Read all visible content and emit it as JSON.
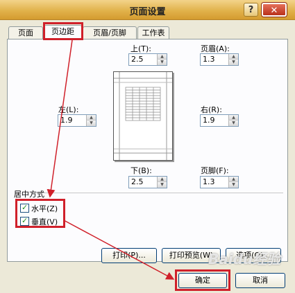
{
  "dialog": {
    "title": "页面设置",
    "help": "?",
    "close": "✕"
  },
  "tabs": [
    "页面",
    "页边距",
    "页眉/页脚",
    "工作表"
  ],
  "margins": {
    "top": {
      "label": "上(T):",
      "value": "2.5"
    },
    "header": {
      "label": "页眉(A):",
      "value": "1.3"
    },
    "left": {
      "label": "左(L):",
      "value": "1.9"
    },
    "right": {
      "label": "右(R):",
      "value": "1.9"
    },
    "bottom": {
      "label": "下(B):",
      "value": "2.5"
    },
    "footer": {
      "label": "页脚(F):",
      "value": "1.3"
    }
  },
  "center": {
    "group_label": "居中方式",
    "horizontal": {
      "label": "水平(Z)",
      "checked": true
    },
    "vertical": {
      "label": "垂直(V)",
      "checked": true
    }
  },
  "buttons": {
    "print": "打印(P)...",
    "preview": "打印预览(W)",
    "options": "选项(O)...",
    "ok": "确定",
    "cancel": "取消"
  },
  "watermark": "Baidu经验",
  "colors": {
    "highlight": "#d0202a",
    "annotation_arrow": "#d0202a",
    "check": "#1f8f1f"
  }
}
